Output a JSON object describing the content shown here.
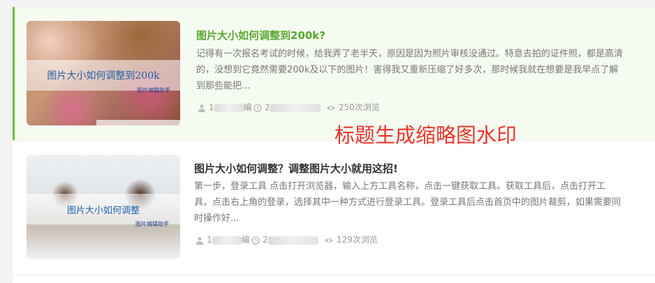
{
  "posts": [
    {
      "title": "图片大小如何调整到200k?",
      "excerpt": "记得有一次报名考试的时候，给我弄了老半天，原因是因为照片审核没通过。特意去拍的证件照，都是高清的，没想到它竟然需要200k及以下的图片！害得我又重新压缩了好多次，那时候我就在想要是我早点了解到那些能把...",
      "thumb_title": "图片大小如何调整到200k",
      "thumb_watermark": "图片编辑助手",
      "author": "1",
      "author_suffix": "编",
      "date": "2",
      "views": "250次浏览"
    },
    {
      "title": "图片大小如何调整？调整图片大小就用这招!",
      "excerpt": "第一步，登录工具 点击打开浏览器，输入上方工具名称，点击一键获取工具。获取工具后，点击打开工具，点击右上角的登录，选择其中一种方式进行登录工具。登录工具后点击首页中的图片裁剪，如果需要同时操作好...",
      "thumb_title": "图片大小如何调整",
      "thumb_watermark": "图片编辑助手",
      "author": "1",
      "author_suffix": "编",
      "date": "2",
      "views": "129次浏览"
    }
  ],
  "overlay_text": "标题生成缩略图水印",
  "colors": {
    "active_accent": "#6cbf3a",
    "active_title": "#5aa82f",
    "overlay": "#e8362c",
    "thumb_text": "#2060a8"
  },
  "icons": [
    "user-icon",
    "clock-icon",
    "eye-icon"
  ]
}
